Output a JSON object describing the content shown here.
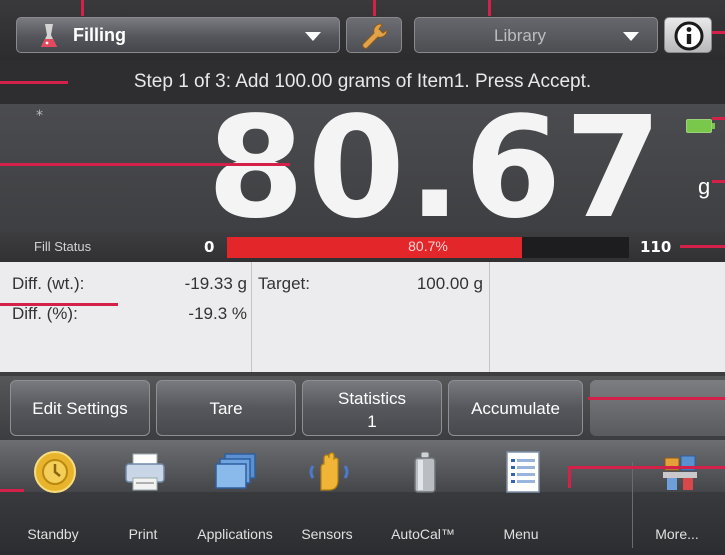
{
  "header": {
    "application_label": "Filling",
    "library_label": "Library",
    "icons": [
      "flask-icon",
      "wrench-icon",
      "info-icon",
      "dropdown-arrow-icon"
    ]
  },
  "prompt": "Step 1 of 3: Add 100.00 grams of Item1.  Press Accept.",
  "display": {
    "stable_indicator": "*",
    "weight": "80.67",
    "unit": "g",
    "battery_icon": "battery-icon"
  },
  "fill_status": {
    "label": "Fill Status",
    "min": "0",
    "max": "110",
    "percent_text": "80.7%",
    "progress_fraction": 0.733,
    "bar_color": "#e3262a"
  },
  "info": {
    "diff_wt_label": "Diff. (wt.):",
    "diff_wt_value": "-19.33 g",
    "diff_pct_label": "Diff. (%):",
    "diff_pct_value": "-19.3 %",
    "target_label": "Target:",
    "target_value": "100.00 g"
  },
  "softkeys": [
    {
      "label": "Edit Settings"
    },
    {
      "label": "Tare"
    },
    {
      "label": "Statistics",
      "sub": "1"
    },
    {
      "label": "Accumulate"
    }
  ],
  "nav": [
    {
      "label": "Standby",
      "icon": "standby-icon"
    },
    {
      "label": "Print",
      "icon": "printer-icon"
    },
    {
      "label": "Applications",
      "icon": "applications-icon"
    },
    {
      "label": "Sensors",
      "icon": "sensors-hand-icon"
    },
    {
      "label": "AutoCal™",
      "icon": "calibration-weight-icon"
    },
    {
      "label": "Menu",
      "icon": "menu-list-icon"
    },
    {
      "label": "More...",
      "icon": "more-icon"
    }
  ],
  "colors": {
    "callout": "#d3214a",
    "background": "#3e3e40",
    "accent_red": "#e3262a"
  }
}
